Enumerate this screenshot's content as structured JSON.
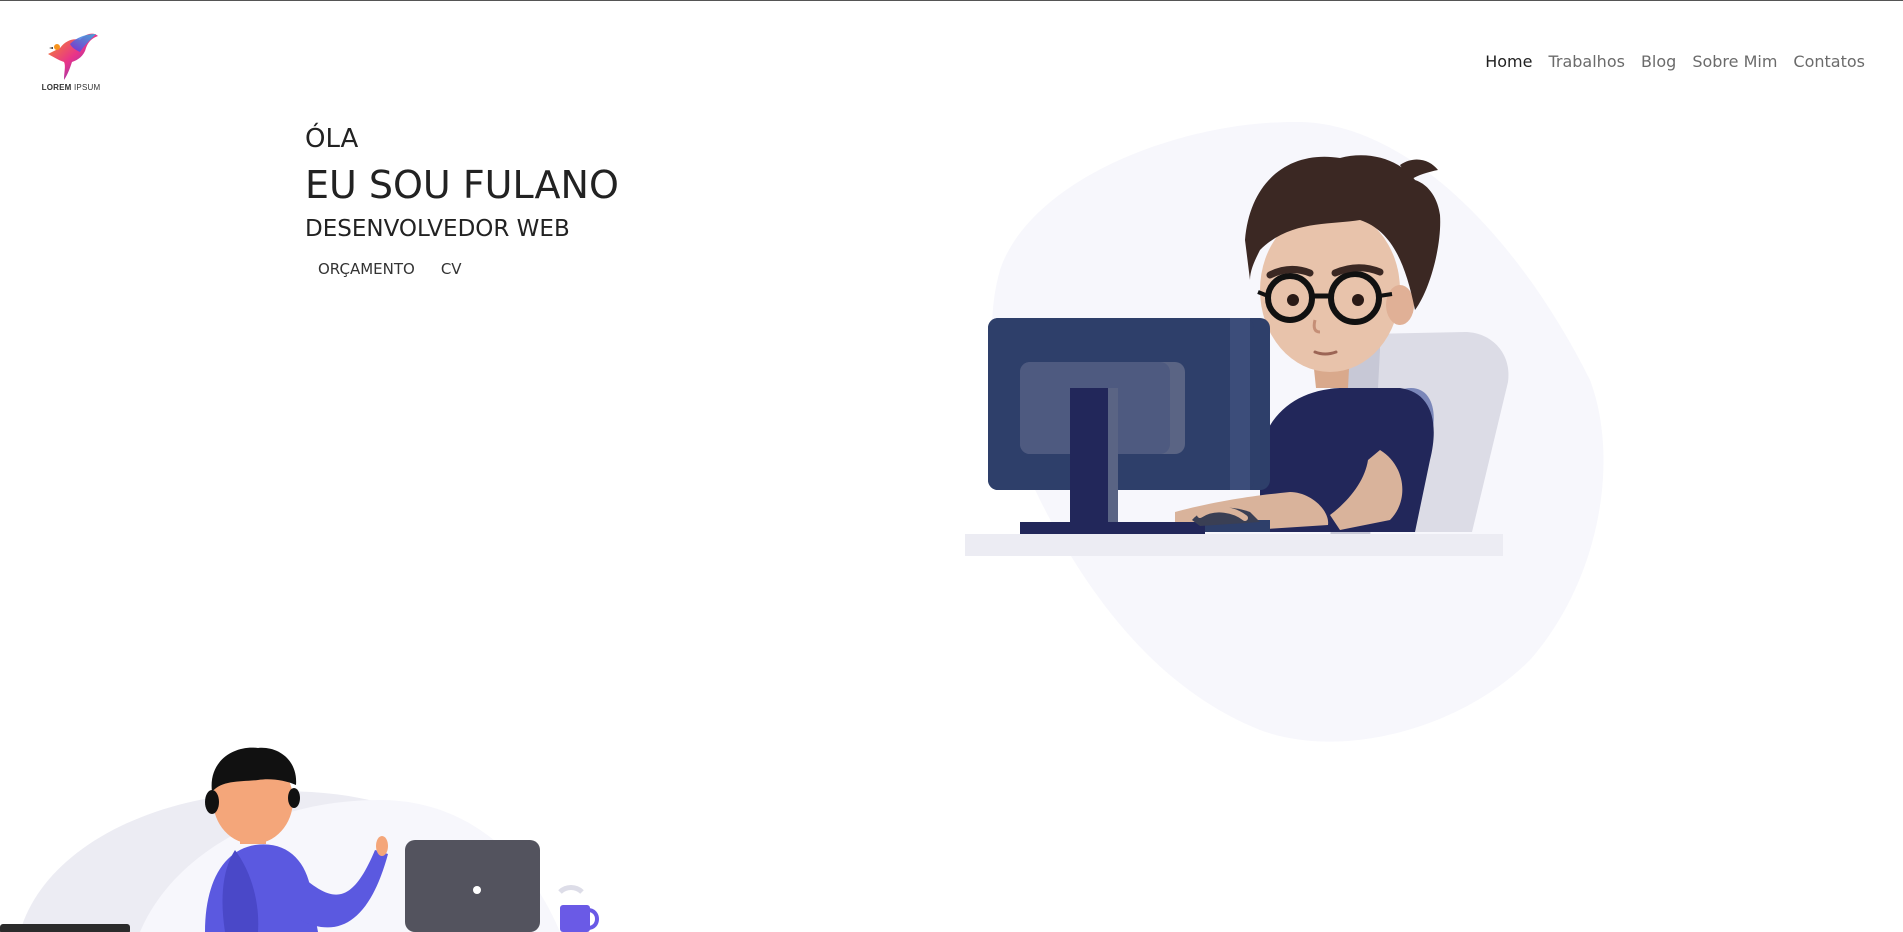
{
  "logo": {
    "brand": "LOREM",
    "suffix": "IPSUM",
    "icon": "bird-icon"
  },
  "nav": {
    "items": [
      {
        "label": "Home",
        "active": true
      },
      {
        "label": "Trabalhos",
        "active": false
      },
      {
        "label": "Blog",
        "active": false
      },
      {
        "label": "Sobre Mim",
        "active": false
      },
      {
        "label": "Contatos",
        "active": false
      }
    ]
  },
  "hero": {
    "greeting": "ÓLA",
    "name": "EU SOU FULANO",
    "role": "DESENVOLVEDOR WEB",
    "buttons": {
      "budget": "ORÇAMENTO",
      "cv": "CV"
    }
  },
  "illustrations": {
    "main": "developer-at-computer-illustration",
    "bottom": "person-with-laptop-illustration"
  },
  "colors": {
    "blob": "#f7f7fc",
    "monitor": "#2e3f6a",
    "shirt": "#22275a",
    "accent": "#5b4bd8"
  }
}
